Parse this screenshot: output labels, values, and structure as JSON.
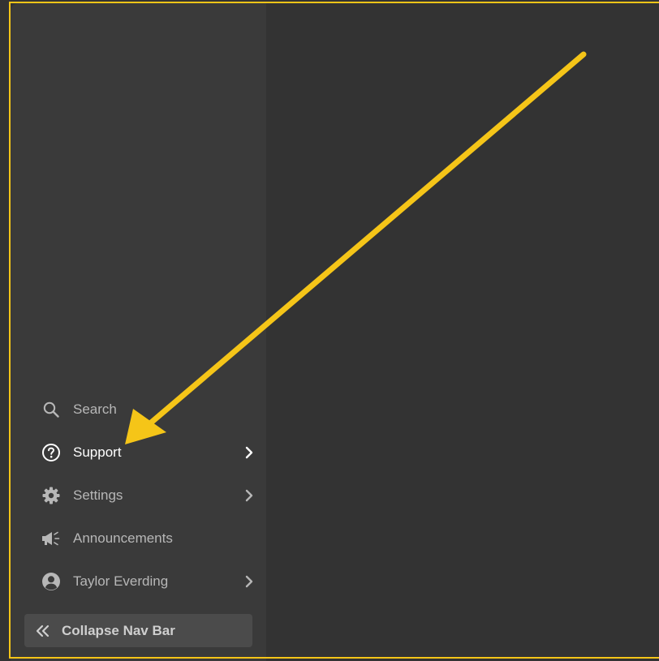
{
  "nav": {
    "items": [
      {
        "label": "Search",
        "icon": "search-icon",
        "has_chevron": false
      },
      {
        "label": "Support",
        "icon": "help-circle-icon",
        "has_chevron": true,
        "active": true
      },
      {
        "label": "Settings",
        "icon": "gear-icon",
        "has_chevron": true
      },
      {
        "label": "Announcements",
        "icon": "megaphone-icon",
        "has_chevron": false
      },
      {
        "label": "Taylor Everding",
        "icon": "user-avatar-icon",
        "has_chevron": true
      }
    ],
    "collapse_label": "Collapse Nav Bar"
  },
  "colors": {
    "highlight": "#f5c518",
    "sidebar_bg": "#3a3a3a",
    "main_bg": "#333333",
    "text_muted": "#b7b7b7",
    "text_active": "#ffffff"
  }
}
